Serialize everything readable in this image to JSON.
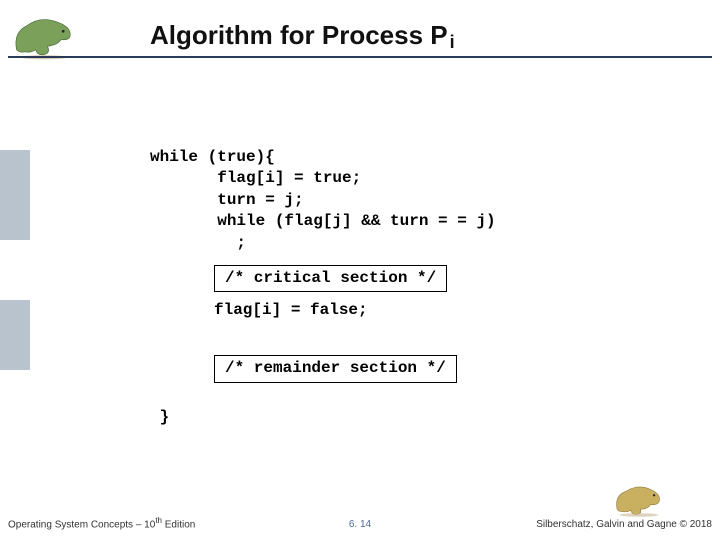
{
  "title": {
    "main": "Algorithm for Process P",
    "sub": "i"
  },
  "code": {
    "l1": "while (true){",
    "l2": "       flag[i] = true;",
    "l3": "       turn = j;",
    "l4": "       while (flag[j] && turn = = j)",
    "l5": "         ;",
    "box1": "/* critical section */",
    "mid": "flag[i] = false;",
    "box2": "/* remainder section */",
    "close": " }"
  },
  "footer": {
    "left_a": "Operating System Concepts – 10",
    "left_sup": "th",
    "left_b": " Edition",
    "center": "6. 14",
    "right": "Silberschatz, Galvin and Gagne © 2018"
  },
  "colors": {
    "rule": "#2a3a5a",
    "side": "#b9c3ce"
  }
}
